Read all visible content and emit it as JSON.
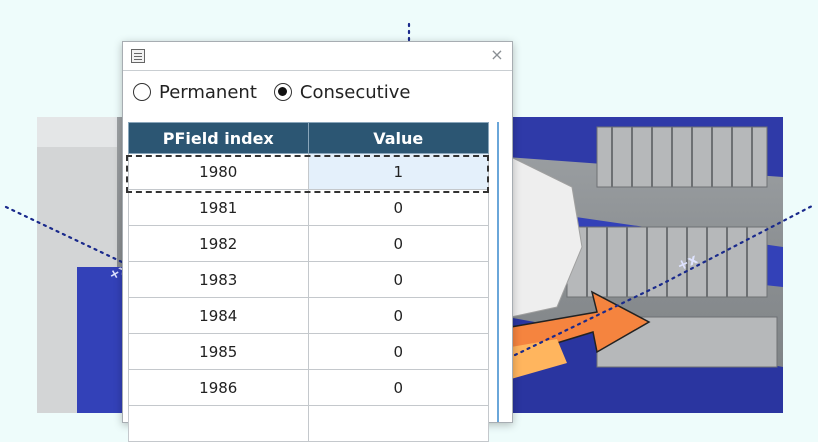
{
  "dialog": {
    "title_icon": "window-icon",
    "close_icon": "close-icon",
    "close_glyph": "×"
  },
  "mode": {
    "options": [
      {
        "label": "Permanent",
        "checked": false
      },
      {
        "label": "Consecutive",
        "checked": true
      }
    ]
  },
  "table": {
    "headers": [
      "PField index",
      "Value"
    ],
    "header_color": "#2c5673",
    "selected_row": 0,
    "rows": [
      {
        "index": "1980",
        "value": "1"
      },
      {
        "index": "1981",
        "value": "0"
      },
      {
        "index": "1982",
        "value": "0"
      },
      {
        "index": "1983",
        "value": "0"
      },
      {
        "index": "1984",
        "value": "0"
      },
      {
        "index": "1985",
        "value": "0"
      },
      {
        "index": "1986",
        "value": "0"
      }
    ]
  },
  "background": {
    "axis_label_left": "+x",
    "axis_label_right": "+x",
    "arrow_color": "#f5843f"
  }
}
